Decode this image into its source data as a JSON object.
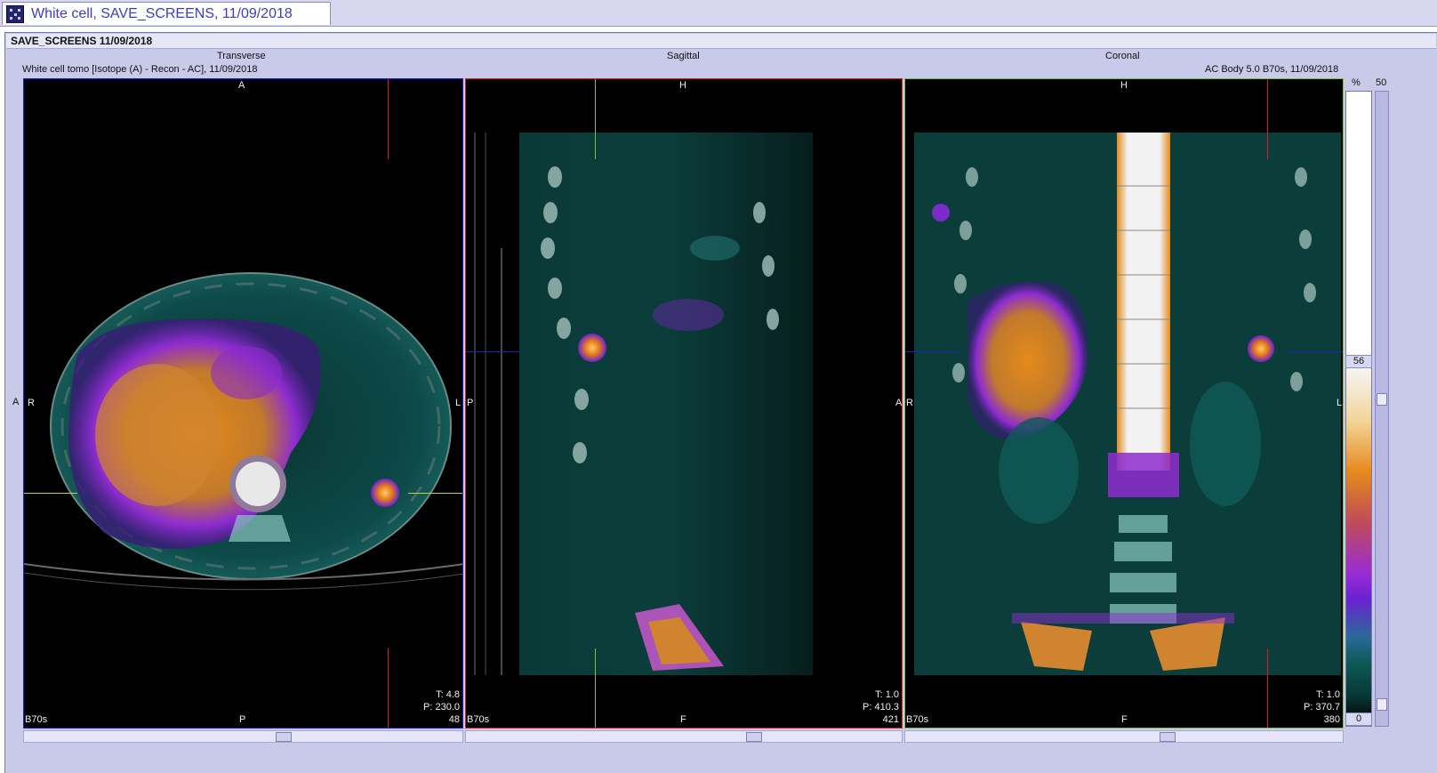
{
  "window": {
    "title": "White cell, SAVE_SCREENS, 11/09/2018"
  },
  "header": {
    "title": "SAVE_SCREENS 11/09/2018"
  },
  "captions": {
    "left_info": "White cell tomo [Isotope (A) - Recon - AC], 11/09/2018",
    "right_info": "AC Body 5.0 B70s, 11/09/2018",
    "percent_sign": "%",
    "scale_max": "50"
  },
  "views": [
    {
      "name": "Transverse",
      "top": "A",
      "bottom": "P",
      "left": "R",
      "right": "L",
      "outer_left": "A",
      "kernel": "B70s",
      "t": "T: 4.8",
      "p": "P: 230.0",
      "slice": "48"
    },
    {
      "name": "Sagittal",
      "top": "H",
      "bottom": "F",
      "left": "P",
      "right": "A",
      "kernel": "B70s",
      "t": "T: 1.0",
      "p": "P: 410.3",
      "slice": "421"
    },
    {
      "name": "Coronal",
      "top": "H",
      "bottom": "F",
      "left": "R",
      "right": "L",
      "kernel": "B70s",
      "t": "T: 1.0",
      "p": "P: 370.7",
      "slice": "380"
    }
  ],
  "colorscale": {
    "marker": "56",
    "min": "0"
  },
  "colors": {
    "transverse_border": "#2020c8",
    "sagittal_border": "#d81e1e",
    "coronal_border": "#7ac43a",
    "frame_bg": "#c9c9ea"
  }
}
